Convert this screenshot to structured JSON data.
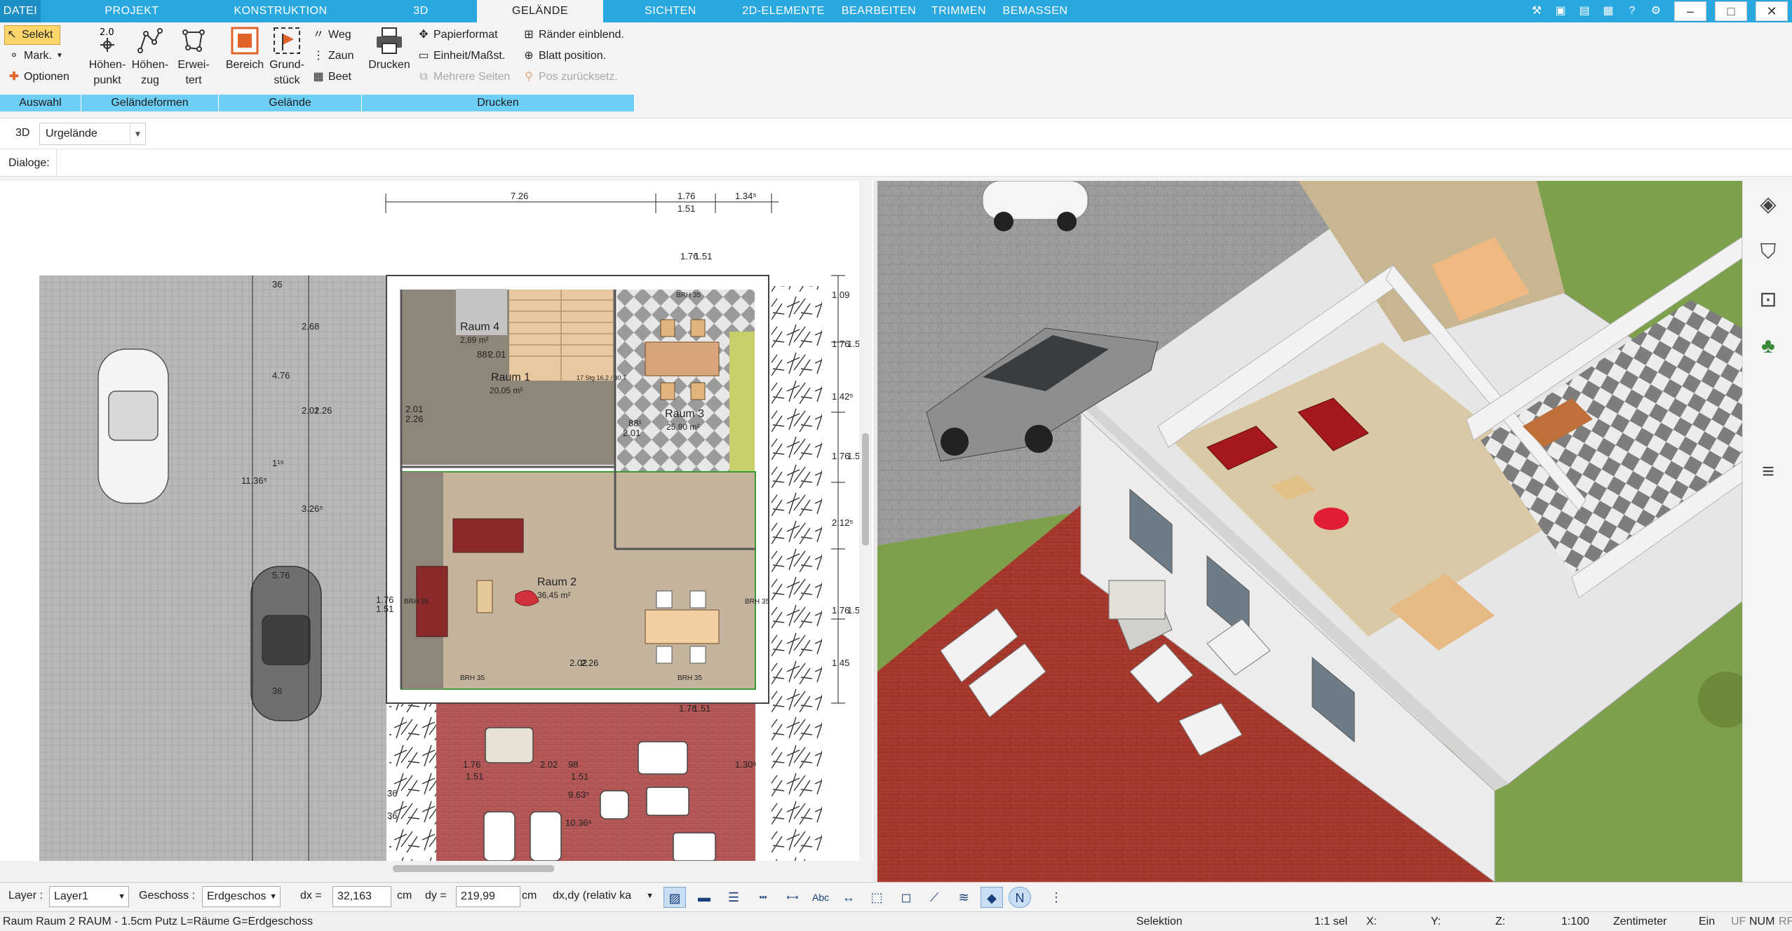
{
  "menubar": {
    "tabs": [
      "DATEI",
      "PROJEKT",
      "KONSTRUKTION",
      "3D",
      "GELÄNDE",
      "SICHTEN",
      "2D-ELEMENTE",
      "BEARBEITEN",
      "TRIMMEN",
      "BEMASSEN"
    ],
    "active_tab": "GELÄNDE"
  },
  "ribbon": {
    "auswahl": {
      "selekt": "Selekt",
      "mark": "Mark.",
      "optionen": "Optionen",
      "group": "Auswahl"
    },
    "gelaendeformen": {
      "hoehenpunkt": [
        "Höhen-",
        "punkt"
      ],
      "hoehenzug": [
        "Höhen-",
        "zug"
      ],
      "erweitert": [
        "Erwei-",
        "tert"
      ],
      "icon_label": "2.0",
      "group": "Geländeformen"
    },
    "gelaende": {
      "bereich": "Bereich",
      "grundstueck": [
        "Grund-",
        "stück"
      ],
      "weg": "Weg",
      "zaun": "Zaun",
      "beet": "Beet",
      "group": "Gelände"
    },
    "drucken": {
      "drucken": "Drucken",
      "papierformat": "Papierformat",
      "einheit": "Einheit/Maßst.",
      "mehrere_seiten": "Mehrere Seiten",
      "raender": "Ränder einblend.",
      "blatt": "Blatt position.",
      "pos_zurueck": "Pos zurücksetz.",
      "group": "Drucken"
    }
  },
  "view_selector": {
    "label": "3D",
    "value": "Urgelände"
  },
  "dialoge_label": "Dialoge:",
  "plan": {
    "dims_top": [
      "7.26",
      "1.76",
      "1.51",
      "1.34⁵"
    ],
    "dims_left": [
      "36",
      "2.68",
      "4.76",
      "2.01",
      "2.26",
      "11.36⁵",
      "1¹⁵",
      "3.26⁵",
      "5.76",
      "36"
    ],
    "dims_right": [
      "1.09",
      "1.76",
      "1.51",
      "1.42⁵",
      "1.76",
      "1.51",
      "2.12⁵",
      "1.76",
      "1.51",
      "1.45"
    ],
    "dims_misc": [
      "1.76",
      "1.51",
      "2.01",
      "2.26",
      "88¹",
      "2.01",
      "88¹",
      "2.01",
      "1.76",
      "1.51",
      "2.02",
      "2.26",
      "1.76",
      "1.51",
      "1.76",
      "1.51",
      "98",
      "2.02",
      "1.51",
      "1.30⁵",
      "9.63⁵",
      "10.36⁵",
      "36",
      "36",
      "BRH 35",
      "BRH 35",
      "BRH 35",
      "BRH 35",
      "BRH 35",
      "17 Stg 16,2 / 30,7"
    ],
    "rooms": [
      {
        "name": "Raum 4",
        "area": "2,89 m²"
      },
      {
        "name": "Raum 1",
        "area": "20,05 m²"
      },
      {
        "name": "Raum 3",
        "area": "25,90 m²"
      },
      {
        "name": "Raum 2",
        "area": "36,45 m²"
      }
    ]
  },
  "side_icons": [
    "layers-icon",
    "chair-icon",
    "fullscreen-icon",
    "tree-icon",
    "menu-icon"
  ],
  "bottombar": {
    "layer_label": "Layer :",
    "layer_value": "Layer1",
    "geschoss_label": "Geschoss :",
    "geschoss_value": "Erdgeschos",
    "dx_label": "dx =",
    "dx_value": "32,163",
    "dx_unit": "cm",
    "dy_label": "dy =",
    "dy_value": "219,99",
    "dy_unit": "cm",
    "mode_value": "dx,dy (relativ ka",
    "icon_abc": "Abc",
    "icon_n": "N"
  },
  "statusbar": {
    "info": "Raum Raum 2 RAUM - 1.5cm Putz L=Räume G=Erdgeschoss",
    "mode": "Selektion",
    "sel": "1:1 sel",
    "x": "X:",
    "y": "Y:",
    "z": "Z:",
    "scale": "1:100",
    "unit": "Zentimeter",
    "ein": "Ein",
    "uf": "UF",
    "num": "NUM",
    "rf": "RF"
  }
}
